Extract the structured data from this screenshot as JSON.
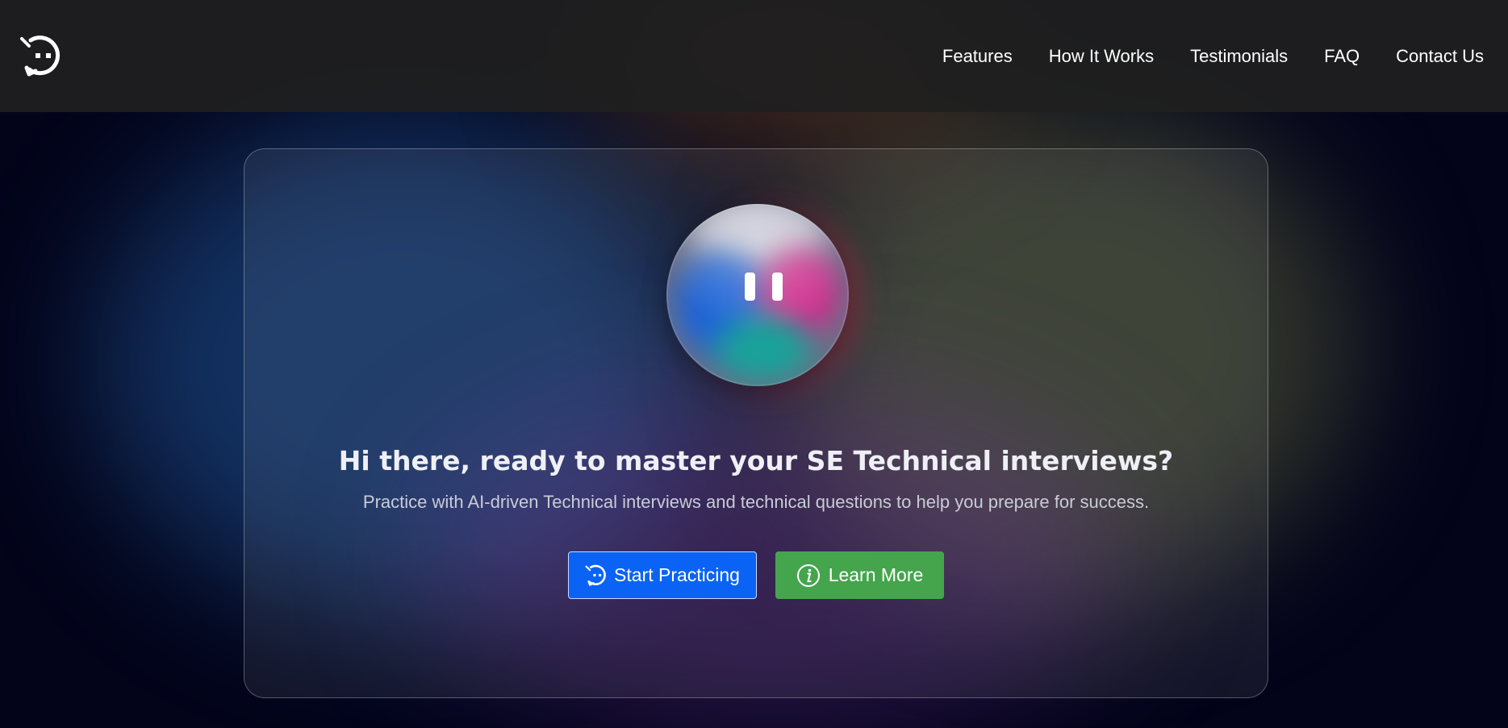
{
  "brand": {
    "logo_icon": "robot-chat-logo-icon"
  },
  "nav": {
    "items": [
      {
        "label": "Features"
      },
      {
        "label": "How It Works"
      },
      {
        "label": "Testimonials"
      },
      {
        "label": "FAQ"
      },
      {
        "label": "Contact Us"
      }
    ]
  },
  "hero": {
    "avatar_icon": "ai-orb-avatar",
    "title": "Hi there, ready to master your SE Technical interviews?",
    "subtitle": "Practice with AI-driven Technical interviews and technical questions to help you prepare for success.",
    "primary_button": {
      "label": "Start Practicing",
      "icon": "robot-chat-icon",
      "color": "#0a63f5"
    },
    "secondary_button": {
      "label": "Learn More",
      "icon": "info-circle-icon",
      "color": "#44a54c"
    }
  },
  "colors": {
    "background": "#03041a",
    "header": "#202020"
  }
}
